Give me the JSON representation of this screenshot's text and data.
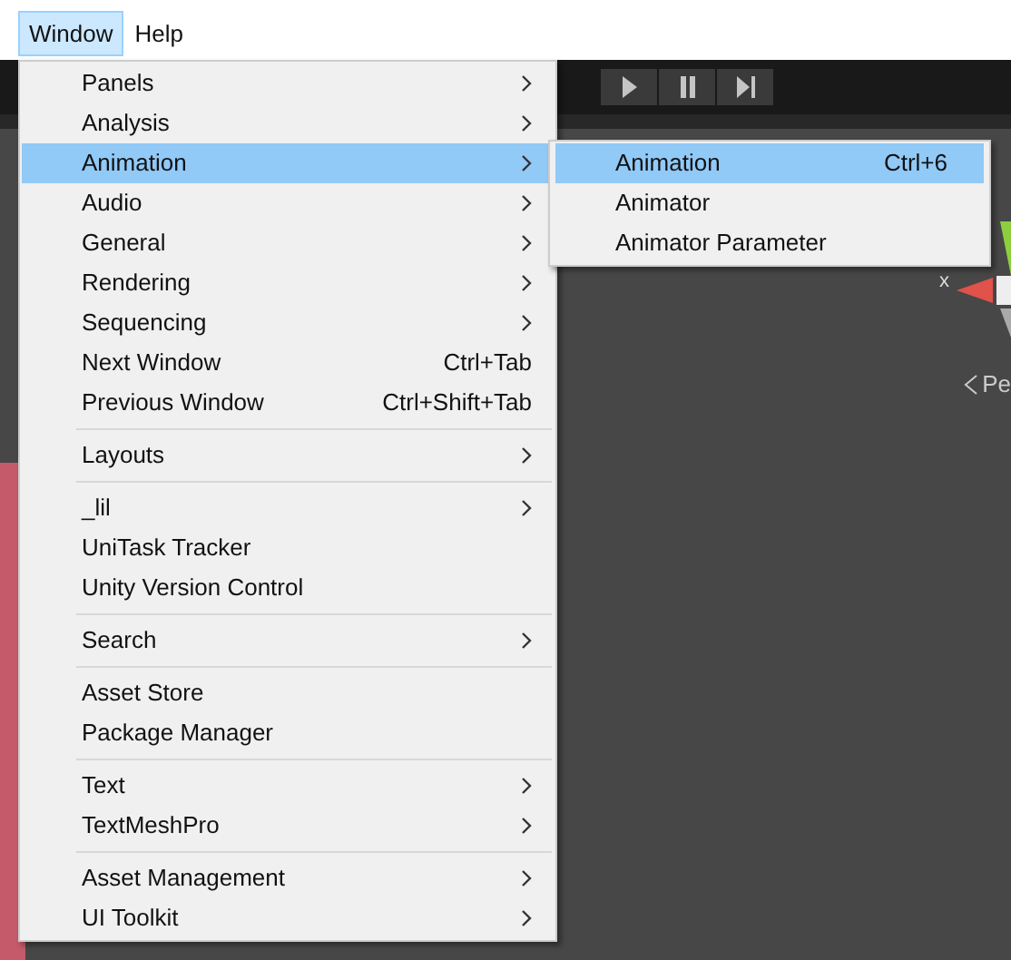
{
  "menubar": [
    {
      "label": "Window",
      "selected": true
    },
    {
      "label": "Help",
      "selected": false
    }
  ],
  "window_menu": {
    "groups": [
      [
        {
          "label": "Panels",
          "submenu": true,
          "selected": false
        },
        {
          "label": "Analysis",
          "submenu": true,
          "selected": false
        },
        {
          "label": "Animation",
          "submenu": true,
          "selected": true
        },
        {
          "label": "Audio",
          "submenu": true,
          "selected": false
        },
        {
          "label": "General",
          "submenu": true,
          "selected": false
        },
        {
          "label": "Rendering",
          "submenu": true,
          "selected": false
        },
        {
          "label": "Sequencing",
          "submenu": true,
          "selected": false
        },
        {
          "label": "Next Window",
          "shortcut": "Ctrl+Tab",
          "submenu": false,
          "selected": false
        },
        {
          "label": "Previous Window",
          "shortcut": "Ctrl+Shift+Tab",
          "submenu": false,
          "selected": false
        }
      ],
      [
        {
          "label": "Layouts",
          "submenu": true,
          "selected": false
        }
      ],
      [
        {
          "label": "_lil",
          "submenu": true,
          "selected": false
        },
        {
          "label": "UniTask Tracker",
          "submenu": false,
          "selected": false
        },
        {
          "label": "Unity Version Control",
          "submenu": false,
          "selected": false
        }
      ],
      [
        {
          "label": "Search",
          "submenu": true,
          "selected": false
        }
      ],
      [
        {
          "label": "Asset Store",
          "submenu": false,
          "selected": false
        },
        {
          "label": "Package Manager",
          "submenu": false,
          "selected": false
        }
      ],
      [
        {
          "label": "Text",
          "submenu": true,
          "selected": false
        },
        {
          "label": "TextMeshPro",
          "submenu": true,
          "selected": false
        }
      ],
      [
        {
          "label": "Asset Management",
          "submenu": true,
          "selected": false
        },
        {
          "label": "UI Toolkit",
          "submenu": true,
          "selected": false
        }
      ]
    ]
  },
  "animation_submenu": [
    {
      "label": "Animation",
      "shortcut": "Ctrl+6",
      "selected": true
    },
    {
      "label": "Animator",
      "selected": false
    },
    {
      "label": "Animator Parameter",
      "selected": false
    }
  ],
  "scene_gizmo": {
    "axis_label": "x",
    "projection_label": "Pe"
  }
}
